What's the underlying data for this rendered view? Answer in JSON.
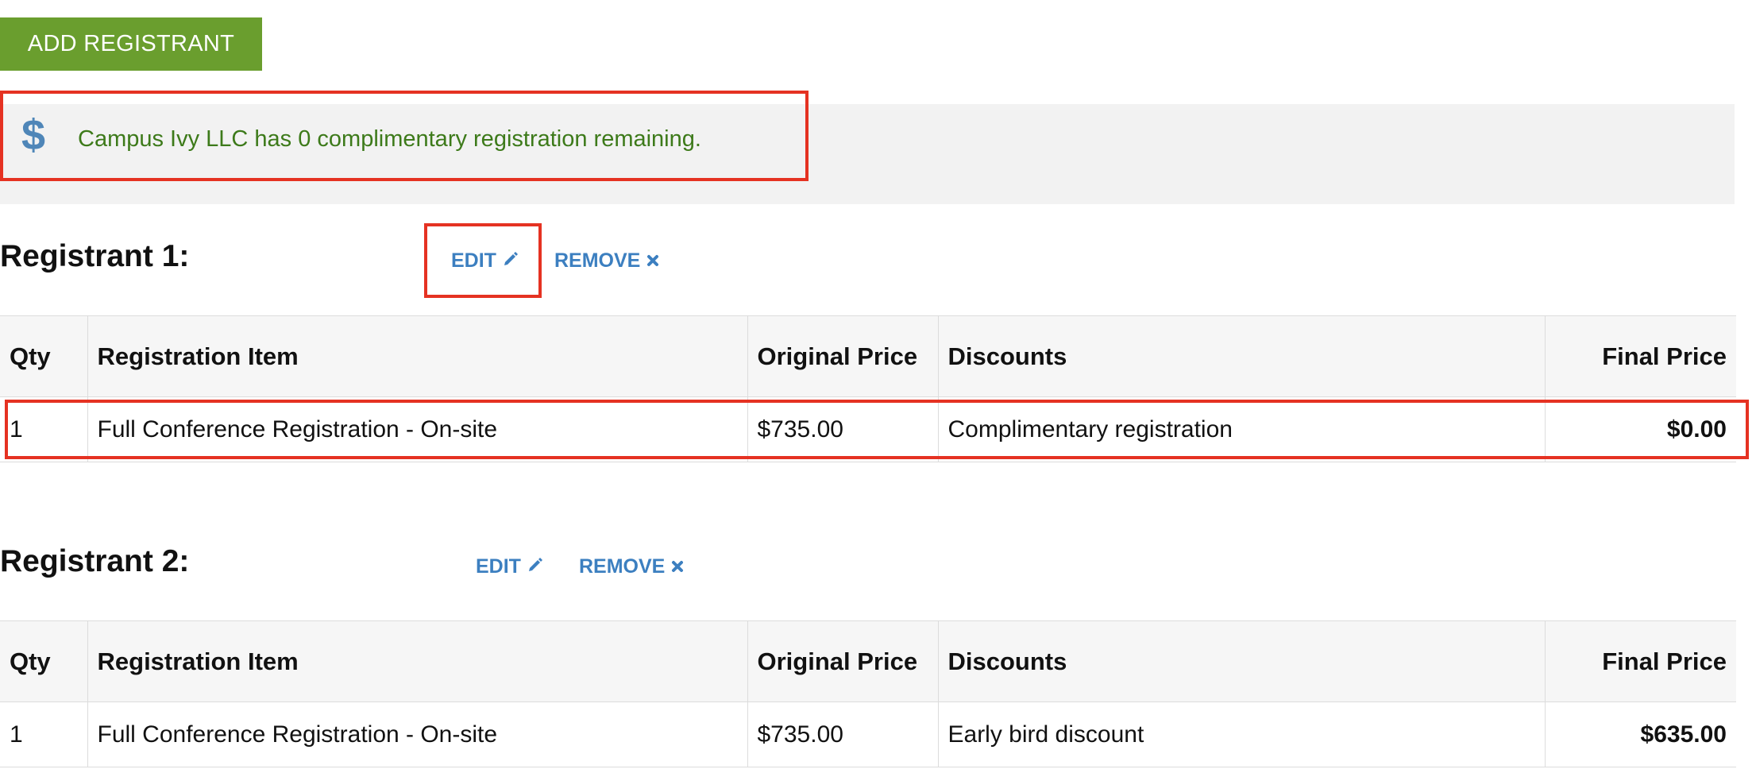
{
  "add_button": {
    "label": "ADD REGISTRANT"
  },
  "notice": {
    "icon": "dollar-icon",
    "icon_glyph": "$",
    "text": "Campus Ivy LLC has 0 complimentary registration remaining."
  },
  "colors": {
    "button_green": "#6a9e2e",
    "notice_text_green": "#3d7a1a",
    "link_blue": "#3c7fc0",
    "highlight_red": "#e53222"
  },
  "table_headers": [
    "Qty",
    "Registration Item",
    "Original Price",
    "Discounts",
    "Final Price"
  ],
  "registrants": [
    {
      "title": "Registrant 1:",
      "edit_label": "EDIT",
      "remove_label": "REMOVE",
      "row": {
        "qty": "1",
        "item": "Full Conference Registration - On-site",
        "original_price": "$735.00",
        "discount": "Complimentary registration",
        "final_price": "$0.00"
      }
    },
    {
      "title": "Registrant 2:",
      "edit_label": "EDIT",
      "remove_label": "REMOVE",
      "row": {
        "qty": "1",
        "item": "Full Conference Registration - On-site",
        "original_price": "$735.00",
        "discount": "Early bird discount",
        "final_price": "$635.00"
      }
    }
  ]
}
